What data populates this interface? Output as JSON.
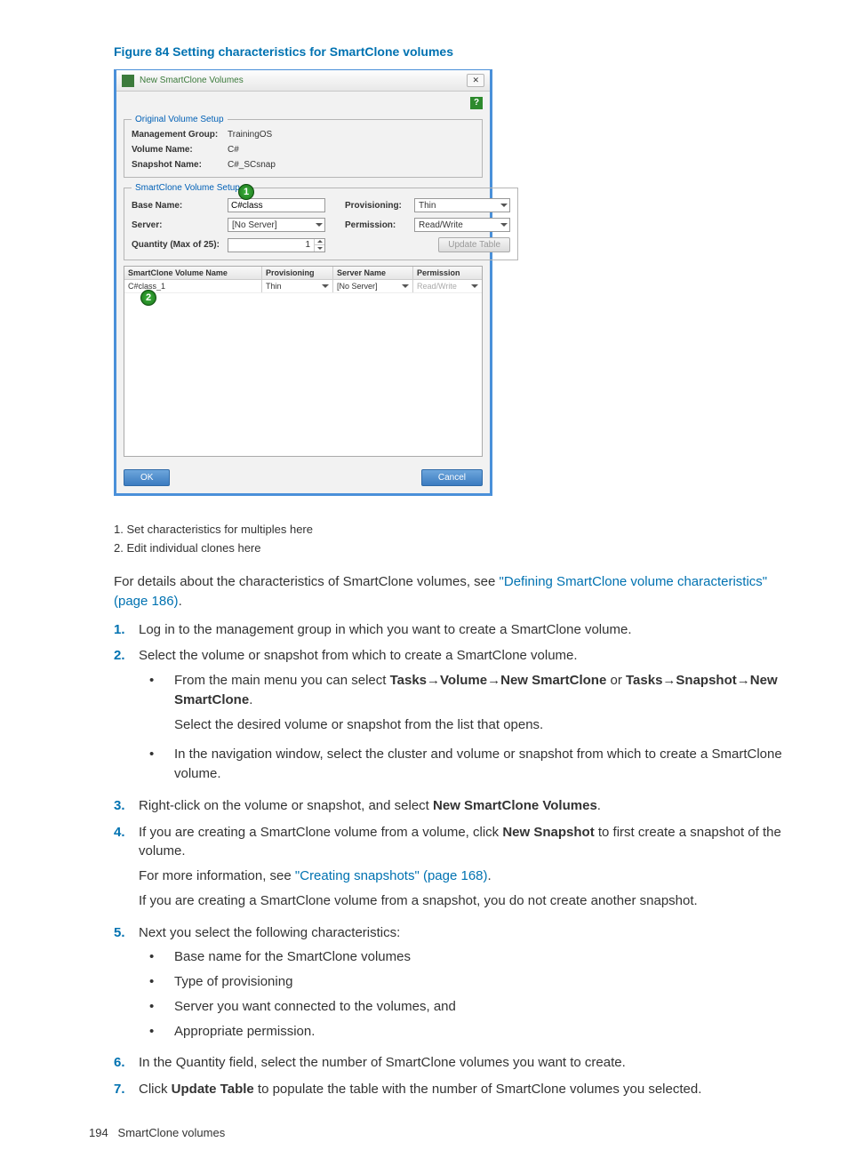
{
  "figure_title": "Figure 84 Setting characteristics for SmartClone volumes",
  "dialog": {
    "window_title": "New SmartClone Volumes",
    "close_glyph": "✕",
    "help_glyph": "?",
    "section1": {
      "legend": "Original Volume Setup",
      "mgmt_group_label": "Management Group:",
      "mgmt_group_value": "TrainingOS",
      "vol_name_label": "Volume Name:",
      "vol_name_value": "C#",
      "snap_name_label": "Snapshot Name:",
      "snap_name_value": "C#_SCsnap"
    },
    "section2": {
      "legend": "SmartClone Volume Setup",
      "base_name_label": "Base Name:",
      "base_name_value": "C#class",
      "prov_label": "Provisioning:",
      "prov_value": "Thin",
      "server_label": "Server:",
      "server_value": "[No Server]",
      "perm_label": "Permission:",
      "perm_value": "Read/Write",
      "qty_label": "Quantity (Max of 25):",
      "qty_value": "1",
      "update_btn": "Update Table",
      "callout1": "1"
    },
    "table": {
      "headers": {
        "name": "SmartClone Volume Name",
        "prov": "Provisioning",
        "serv": "Server Name",
        "perm": "Permission"
      },
      "row": {
        "name": "C#class_1",
        "prov": "Thin",
        "serv": "[No Server]",
        "perm": "Read/Write"
      },
      "callout2": "2"
    },
    "ok": "OK",
    "cancel": "Cancel"
  },
  "legend_items": {
    "i1": "1. Set characteristics for multiples here",
    "i2": "2. Edit individual clones here"
  },
  "intro": {
    "t1": "For details about the characteristics of SmartClone volumes, see ",
    "link1": "\"Defining SmartClone volume characteristics\" (page 186)",
    "t2": "."
  },
  "steps": {
    "s1": "Log in to the management group in which you want to create a SmartClone volume.",
    "s2": "Select the volume or snapshot from which to create a SmartClone volume.",
    "s2_b1_a": "From the main menu you can select ",
    "s2_b1_b": "Tasks",
    "s2_b1_arr": "→",
    "s2_b1_c": "Volume",
    "s2_b1_d": "New SmartClone",
    "s2_b1_e": " or ",
    "s2_b1_f": "Snapshot",
    "s2_b1_g": ".",
    "s2_b1_p2": "Select the desired volume or snapshot from the list that opens.",
    "s2_b2": "In the navigation window, select the cluster and volume or snapshot from which to create a SmartClone volume.",
    "s3_a": "Right-click on the volume or snapshot, and select ",
    "s3_b": "New SmartClone Volumes",
    "s3_c": ".",
    "s4_a": "If you are creating a SmartClone volume from a volume, click ",
    "s4_b": "New Snapshot",
    "s4_c": " to first create a snapshot of the volume.",
    "s4_p2_a": "For more information, see ",
    "s4_p2_link": "\"Creating snapshots\" (page 168)",
    "s4_p2_b": ".",
    "s4_p3": "If you are creating a SmartClone volume from a snapshot, you do not create another snapshot.",
    "s5": "Next you select the following characteristics:",
    "s5_b1": "Base name for the SmartClone volumes",
    "s5_b2": "Type of provisioning",
    "s5_b3": "Server you want connected to the volumes, and",
    "s5_b4": "Appropriate permission.",
    "s6": "In the Quantity field, select the number of SmartClone volumes you want to create.",
    "s7_a": "Click ",
    "s7_b": "Update Table",
    "s7_c": " to populate the table with the number of SmartClone volumes you selected."
  },
  "step_nums": {
    "n1": "1.",
    "n2": "2.",
    "n3": "3.",
    "n4": "4.",
    "n5": "5.",
    "n6": "6.",
    "n7": "7."
  },
  "footer": {
    "page": "194",
    "section": "SmartClone volumes"
  }
}
